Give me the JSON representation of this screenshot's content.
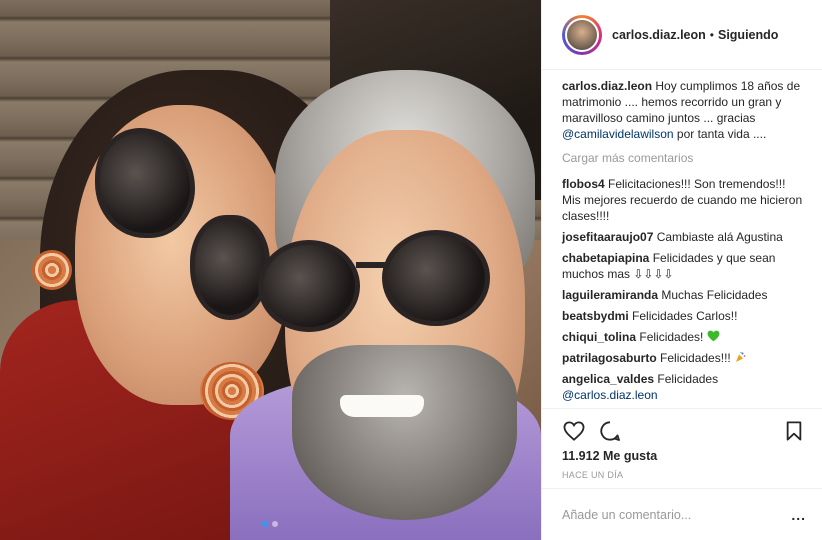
{
  "header": {
    "username": "carlos.diaz.leon",
    "separator": "•",
    "follow_status": "Siguiendo"
  },
  "caption": {
    "user": "carlos.diaz.leon",
    "text": "Hoy cumplimos 18 años de matrimonio .... hemos recorrido un gran y maravilloso camino juntos ... gracias",
    "mention": "@camilavidelawilson",
    "text_after": "por tanta vida ...."
  },
  "load_more": "Cargar más comentarios",
  "comments": [
    {
      "user": "flobos4",
      "text": "Felicitaciones!!! Son tremendos!!! Mis mejores recuerdo de cuando me hicieron clases!!!!"
    },
    {
      "user": "josefitaaraujo07",
      "text": "Cambiaste alá Agustina"
    },
    {
      "user": "chabetapiapina",
      "text": "Felicidades y que sean muchos mas ⇩⇩⇩⇩"
    },
    {
      "user": "laguileramiranda",
      "text": "Muchas Felicidades"
    },
    {
      "user": "beatsbydmi",
      "text": "Felicidades Carlos!!"
    },
    {
      "user": "chiqui_tolina",
      "text": "Felicidades!",
      "emoji": "green-heart-icon"
    },
    {
      "user": "patrilagosaburto",
      "text": "Felicidades!!!",
      "emoji": "party-popper-icon"
    },
    {
      "user": "angelica_valdes",
      "text": "Felicidades",
      "mention": "@carlos.diaz.leon"
    }
  ],
  "actions": {
    "like_icon": "heart-icon",
    "comment_icon": "comment-icon",
    "save_icon": "bookmark-icon"
  },
  "likes": "11.912 Me gusta",
  "timestamp": "HACE UN DÍA",
  "add_comment": {
    "placeholder": "Añade un comentario...",
    "more": "..."
  },
  "carousel": {
    "count": 2,
    "active": 1
  },
  "colors": {
    "accent": "#3897f0",
    "mention": "#003569",
    "muted": "#999999",
    "green_heart": "#3dba2b"
  }
}
